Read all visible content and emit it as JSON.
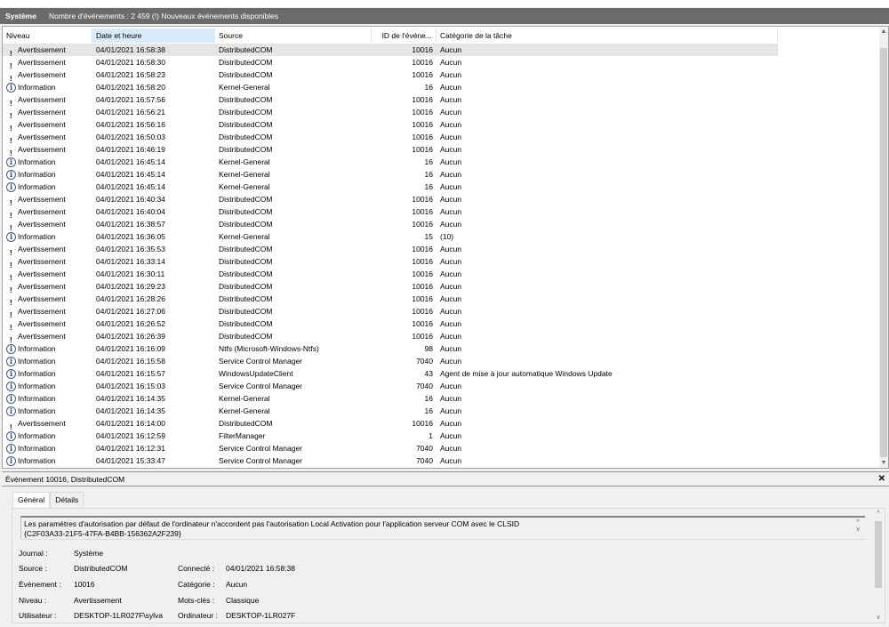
{
  "header": {
    "log": "Système",
    "summary": "Nombre d'événements : 2 459 (!) Nouveaux événements disponibles"
  },
  "columns": [
    "Niveau",
    "Date et heure",
    "Source",
    "ID de l'événe...",
    "Catégorie de la tâche"
  ],
  "rows": [
    [
      "Avertissement",
      "04/01/2021 16:58:38",
      "DistributedCOM",
      "10016",
      "Aucun"
    ],
    [
      "Avertissement",
      "04/01/2021 16:58:30",
      "DistributedCOM",
      "10016",
      "Aucun"
    ],
    [
      "Avertissement",
      "04/01/2021 16:58:23",
      "DistributedCOM",
      "10016",
      "Aucun"
    ],
    [
      "Information",
      "04/01/2021 16:58:20",
      "Kernel-General",
      "16",
      "Aucun"
    ],
    [
      "Avertissement",
      "04/01/2021 16:57:56",
      "DistributedCOM",
      "10016",
      "Aucun"
    ],
    [
      "Avertissement",
      "04/01/2021 16:56:21",
      "DistributedCOM",
      "10016",
      "Aucun"
    ],
    [
      "Avertissement",
      "04/01/2021 16:56:16",
      "DistributedCOM",
      "10016",
      "Aucun"
    ],
    [
      "Avertissement",
      "04/01/2021 16:50:03",
      "DistributedCOM",
      "10016",
      "Aucun"
    ],
    [
      "Avertissement",
      "04/01/2021 16:46:19",
      "DistributedCOM",
      "10016",
      "Aucun"
    ],
    [
      "Information",
      "04/01/2021 16:45:14",
      "Kernel-General",
      "16",
      "Aucun"
    ],
    [
      "Information",
      "04/01/2021 16:45:14",
      "Kernel-General",
      "16",
      "Aucun"
    ],
    [
      "Information",
      "04/01/2021 16:45:14",
      "Kernel-General",
      "16",
      "Aucun"
    ],
    [
      "Avertissement",
      "04/01/2021 16:40:34",
      "DistributedCOM",
      "10016",
      "Aucun"
    ],
    [
      "Avertissement",
      "04/01/2021 16:40:04",
      "DistributedCOM",
      "10016",
      "Aucun"
    ],
    [
      "Avertissement",
      "04/01/2021 16:38:57",
      "DistributedCOM",
      "10016",
      "Aucun"
    ],
    [
      "Information",
      "04/01/2021 16:36:05",
      "Kernel-General",
      "15",
      "(10)"
    ],
    [
      "Avertissement",
      "04/01/2021 16:35:53",
      "DistributedCOM",
      "10016",
      "Aucun"
    ],
    [
      "Avertissement",
      "04/01/2021 16:33:14",
      "DistributedCOM",
      "10016",
      "Aucun"
    ],
    [
      "Avertissement",
      "04/01/2021 16:30:11",
      "DistributedCOM",
      "10016",
      "Aucun"
    ],
    [
      "Avertissement",
      "04/01/2021 16:29:23",
      "DistributedCOM",
      "10016",
      "Aucun"
    ],
    [
      "Avertissement",
      "04/01/2021 16:28:26",
      "DistributedCOM",
      "10016",
      "Aucun"
    ],
    [
      "Avertissement",
      "04/01/2021 16:27:06",
      "DistributedCOM",
      "10016",
      "Aucun"
    ],
    [
      "Avertissement",
      "04/01/2021 16:26:52",
      "DistributedCOM",
      "10016",
      "Aucun"
    ],
    [
      "Avertissement",
      "04/01/2021 16:26:39",
      "DistributedCOM",
      "10016",
      "Aucun"
    ],
    [
      "Information",
      "04/01/2021 16:16:09",
      "Ntfs (Microsoft-Windows-Ntfs)",
      "98",
      "Aucun"
    ],
    [
      "Information",
      "04/01/2021 16:15:58",
      "Service Control Manager",
      "7040",
      "Aucun"
    ],
    [
      "Information",
      "04/01/2021 16:15:57",
      "WindowsUpdateClient",
      "43",
      "Agent de mise à jour automatique Windows Update"
    ],
    [
      "Information",
      "04/01/2021 16:15:03",
      "Service Control Manager",
      "7040",
      "Aucun"
    ],
    [
      "Information",
      "04/01/2021 16:14:35",
      "Kernel-General",
      "16",
      "Aucun"
    ],
    [
      "Information",
      "04/01/2021 16:14:35",
      "Kernel-General",
      "16",
      "Aucun"
    ],
    [
      "Avertissement",
      "04/01/2021 16:14:00",
      "DistributedCOM",
      "10016",
      "Aucun"
    ],
    [
      "Information",
      "04/01/2021 16:12:59",
      "FilterManager",
      "1",
      "Aucun"
    ],
    [
      "Information",
      "04/01/2021 16:12:31",
      "Service Control Manager",
      "7040",
      "Aucun"
    ],
    [
      "Information",
      "04/01/2021 15:33:47",
      "Service Control Manager",
      "7040",
      "Aucun"
    ]
  ],
  "detail": {
    "title": "Événement 10016, DistributedCOM",
    "tabs": [
      "Général",
      "Détails"
    ],
    "message": "Les paramètres d'autorisation par défaut de l'ordinateur n'accordent pas l'autorisation Local Activation pour l'application serveur COM avec le CLSID",
    "message_line2": "{C2F03A33-21F5-47FA-B4BB-156362A2F239}",
    "fields": {
      "journal_label": "Journal :",
      "journal": "Système",
      "source_label": "Source :",
      "source": "DistributedCOM",
      "event_label": "Événement :",
      "event": "10016",
      "level_label": "Niveau :",
      "level": "Avertissement",
      "user_label": "Utilisateur :",
      "user": "DESKTOP-1LR027F\\sylva",
      "logged_label": "Connecté :",
      "logged": "04/01/2021 16:58:38",
      "category_label": "Catégorie :",
      "category": "Aucun",
      "keywords_label": "Mots-clés :",
      "keywords": "Classique",
      "computer_label": "Ordinateur :",
      "computer": "DESKTOP-1LR027F"
    }
  }
}
